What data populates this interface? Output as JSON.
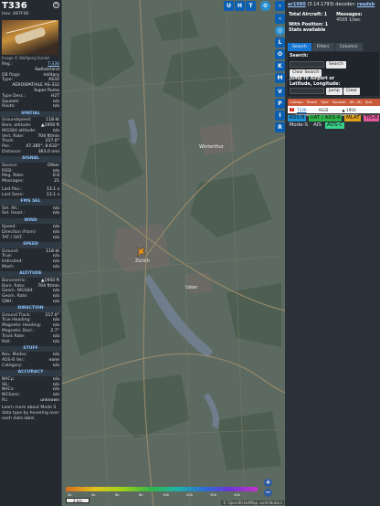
{
  "aircraft": {
    "callsign": "T336",
    "hex": "Hex: 4B7F00",
    "close_icon": "close-icon",
    "photo_credit": "Image © Wolfgang Kunkel",
    "fields": [
      {
        "k": "Reg.:",
        "v": "T-336",
        "link": true
      },
      {
        "k": "",
        "v": "Switzerland"
      },
      {
        "k": "DB flags:",
        "v": "military"
      },
      {
        "k": "Type:",
        "v": "AS32"
      },
      {
        "k": "",
        "v": "AEROSPATIALE AS-332"
      },
      {
        "k": "",
        "v": "Super Puma"
      },
      {
        "k": "Type Desc.:",
        "v": "H2T"
      },
      {
        "k": "Squawk:",
        "v": "n/a"
      },
      {
        "k": "Route:",
        "v": "n/a"
      }
    ]
  },
  "sections": [
    {
      "title": "SPATIAL",
      "rows": [
        {
          "k": "Groundspeed:",
          "v": "118 kt"
        },
        {
          "k": "Baro. altitude:",
          "v": "▲1950 ft"
        },
        {
          "k": "WGS84 altitude:",
          "v": "n/a"
        },
        {
          "k": "Vert. Rate:",
          "v": "704 ft/min"
        },
        {
          "k": "Track:",
          "v": "217.0°"
        },
        {
          "k": "Pos.:",
          "v": "47.385°, 8.632°"
        },
        {
          "k": "Distance:",
          "v": "363.0 nmi"
        }
      ]
    },
    {
      "title": "SIGNAL",
      "rows": [
        {
          "k": "Source:",
          "v": "Other"
        },
        {
          "k": "RSSI:",
          "v": "n/a"
        },
        {
          "k": "Msg. Rate:",
          "v": "0.0"
        },
        {
          "k": "Messages:",
          "v": "21"
        },
        {
          "k": "",
          "v": ""
        },
        {
          "k": "Last Pos.:",
          "v": "13.1 s"
        },
        {
          "k": "Last Seen:",
          "v": "13.1 s"
        }
      ]
    },
    {
      "title": "FMS SEL",
      "rows": [
        {
          "k": "Sel. Alt.:",
          "v": "n/a"
        },
        {
          "k": "Sel. Head.:",
          "v": "n/a"
        }
      ]
    },
    {
      "title": "WIND",
      "rows": [
        {
          "k": "Speed:",
          "v": "n/a"
        },
        {
          "k": "Direction (from):",
          "v": "n/a"
        },
        {
          "k": "TAT / OAT:",
          "v": "n/a"
        }
      ]
    },
    {
      "title": "SPEED",
      "rows": [
        {
          "k": "Ground:",
          "v": "118 kt"
        },
        {
          "k": "True:",
          "v": "n/a"
        },
        {
          "k": "Indicated:",
          "v": "n/a"
        },
        {
          "k": "Mach:",
          "v": "n/a"
        }
      ]
    },
    {
      "title": "ALTITUDE",
      "rows": [
        {
          "k": "Barometric:",
          "v": "▲1950 ft"
        },
        {
          "k": "Baro. Rate:",
          "v": "704 ft/min"
        },
        {
          "k": "Geom. WGS84:",
          "v": "n/a"
        },
        {
          "k": "Geom. Rate:",
          "v": "n/a"
        },
        {
          "k": "QNH:",
          "v": "n/a"
        }
      ]
    },
    {
      "title": "DIRECTION",
      "rows": [
        {
          "k": "Ground Track:",
          "v": "217.0°"
        },
        {
          "k": "True Heading:",
          "v": "n/a"
        },
        {
          "k": "Magnetic Heading:",
          "v": "n/a"
        },
        {
          "k": "Magnetic Decl.:",
          "v": "2.7°"
        },
        {
          "k": "Track Rate:",
          "v": "n/a"
        },
        {
          "k": "Roll:",
          "v": "n/a"
        }
      ]
    },
    {
      "title": "STUFF",
      "rows": [
        {
          "k": "Nav. Modes:",
          "v": "n/a"
        },
        {
          "k": "ADS-B Ver.:",
          "v": "none"
        },
        {
          "k": "Category:",
          "v": "n/a"
        }
      ]
    },
    {
      "title": "ACCURACY",
      "rows": [
        {
          "k": "NACp:",
          "v": "n/a"
        },
        {
          "k": "SIL:",
          "v": "n/a"
        },
        {
          "k": "NACv:",
          "v": "n/a"
        },
        {
          "k": "NICbaro:",
          "v": "n/a"
        },
        {
          "k": "Rc:",
          "v": "unknown"
        }
      ]
    }
  ],
  "footer_note": "Learn more about Mode S data type by hovering over each data label.",
  "map": {
    "top_buttons": [
      "U",
      "H",
      "T"
    ],
    "side_buttons": [
      "L",
      "O",
      "K",
      "M",
      "P",
      "I",
      "R"
    ],
    "side_icons": [
      "settings-icon",
      "layers-icon",
      "fullscreen-icon"
    ],
    "labels": [
      "Zürich",
      "Winterthur",
      "Uster"
    ],
    "osm_credit": "© OpenStreetMap contributors",
    "scale": "2 km",
    "zoom_in": "+",
    "zoom_out": "−",
    "alt_labels": [
      "2k",
      "4k",
      "6k",
      "8k",
      "10k",
      "20k",
      "30k",
      "40k"
    ]
  },
  "side": {
    "collapse_icon": "‹",
    "version_link": "ar1090",
    "version_text": "(3.14.1793) decoder:",
    "version_status": "readsb",
    "total_label": "Total Aircraft:",
    "total": "1",
    "messages_label": "Messages:",
    "messages": "4509 1/sec",
    "position_label": "With Position:",
    "position": "1",
    "stats_label": "Stats available",
    "tabs": [
      "Search",
      "Filters",
      "Columns"
    ],
    "search_label": "Search:",
    "search_button": "Search",
    "clear_search": "Clear Search",
    "jump_label": "Jump to Airport or Latitude, Longitude:",
    "jump_button": "Jump",
    "clear_button": "Clear",
    "columns": [
      "Callsign",
      "Route",
      "Type",
      "Squawk",
      "Alt. (ft)",
      "Spd"
    ],
    "row": {
      "callsign": "T336",
      "type": "AS32",
      "alt": "▲ 1950"
    },
    "sources": [
      {
        "label": "ADS-B",
        "color": "#1f8fd6",
        "fg": "#111"
      },
      {
        "label": "UAT / ADS-R",
        "color": "#2db54a",
        "fg": "#111"
      },
      {
        "label": "MLAT",
        "color": "#e0a21b",
        "fg": "#111"
      },
      {
        "label": "TIS-B",
        "color": "#e05a9a",
        "fg": "#111"
      },
      {
        "label": "Mode-S",
        "color": "",
        "fg": "#e6e6e6"
      },
      {
        "label": "AIS",
        "color": "",
        "fg": "#e6e6e6"
      },
      {
        "label": "ADS-C",
        "color": "#3ad18a",
        "fg": "#111"
      }
    ]
  }
}
